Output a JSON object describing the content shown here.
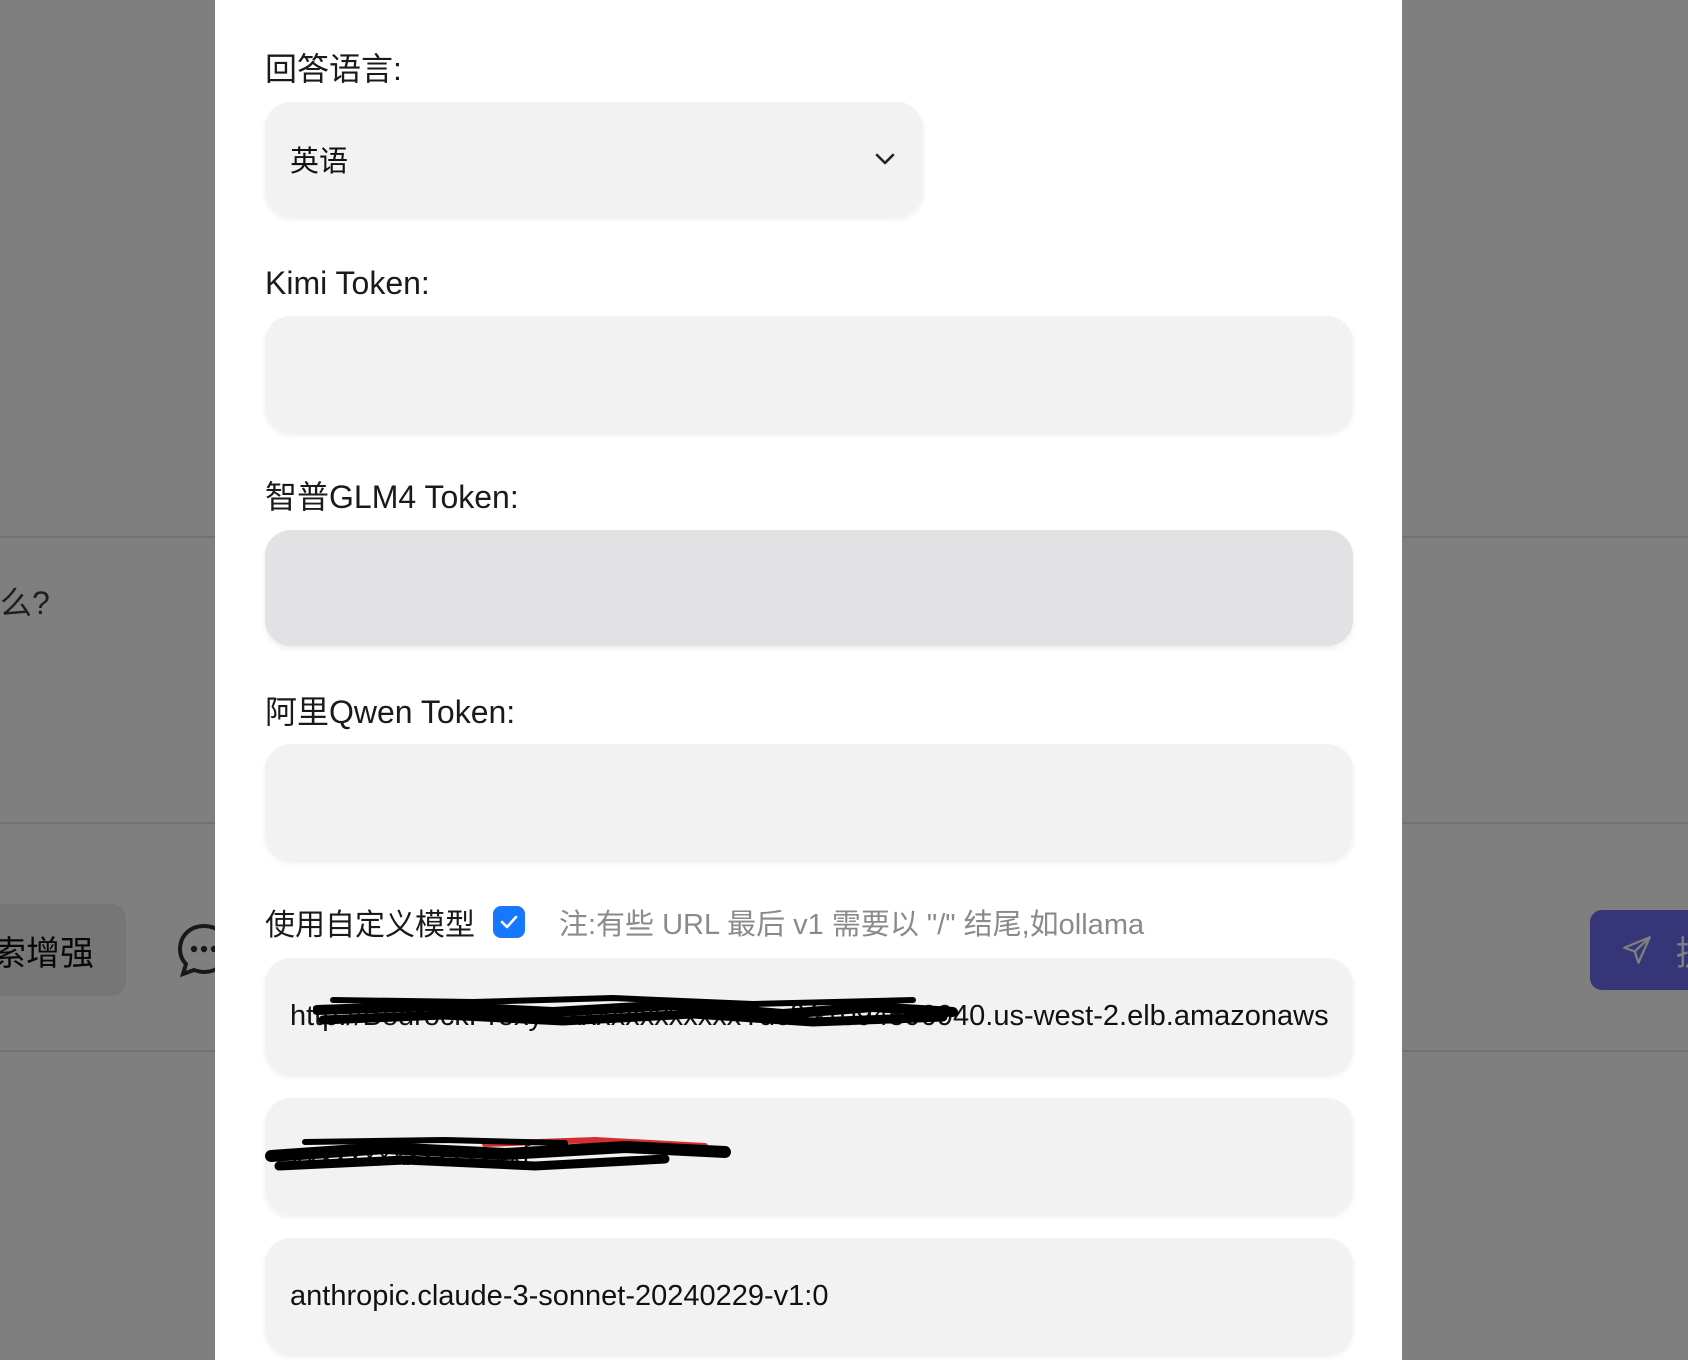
{
  "background": {
    "question_fragment": "么?",
    "chip_label": "索增强",
    "send_label": "提"
  },
  "modal": {
    "answer_language": {
      "label": "回答语言:",
      "selected": "英语"
    },
    "kimi": {
      "label": "Kimi Token:",
      "value": ""
    },
    "glm4": {
      "label": "智普GLM4 Token:",
      "value": ""
    },
    "qwen": {
      "label": "阿里Qwen Token:",
      "value": ""
    },
    "custom_model": {
      "label": "使用自定义模型",
      "checked": true,
      "note": "注:有些 URL 最后 v1 需要以 \"/\" 结尾,如ollama",
      "url_value": "http://BedrockProxy-xxxxxxxxxxxxxYucfY-1094590940.us-west-2.elb.amazonaws.c",
      "api_key_value": "xxxxxxxxxxxxxxxxf",
      "model_value": "anthropic.claude-3-sonnet-20240229-v1:0"
    }
  },
  "colors": {
    "accent": "#1677ff",
    "send_button": "#6c6af0",
    "input_bg": "#f2f2f2",
    "input_disabled_bg": "#e2e2e4",
    "overlay": "rgba(0,0,0,0.5)"
  },
  "icons": {
    "select_arrow": "chevron-down-icon",
    "checkbox": "checkmark-icon",
    "chat": "chat-bubble-icon",
    "send": "paper-plane-icon"
  }
}
